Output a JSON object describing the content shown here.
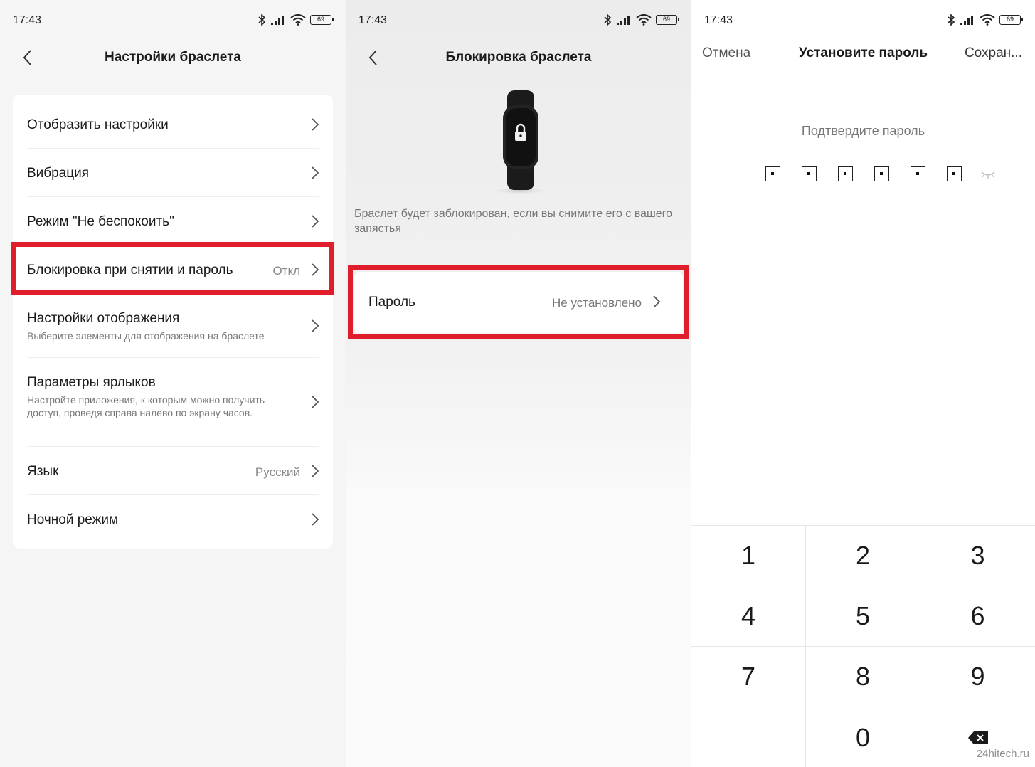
{
  "screen1": {
    "status_time": "17:43",
    "battery": "69",
    "title": "Настройки браслета",
    "items": [
      {
        "label": "Отобразить настройки"
      },
      {
        "label": "Вибрация"
      },
      {
        "label": "Режим \"Не беспокоить\""
      },
      {
        "label": "Блокировка при снятии и пароль",
        "value": "Откл"
      },
      {
        "label": "Настройки отображения",
        "sub": "Выберите элементы для отображения на браслете"
      },
      {
        "label": "Параметры ярлыков",
        "sub": "Настройте приложения, к которым можно получить доступ, проведя справа налево по экрану часов."
      },
      {
        "label": "Язык",
        "value": "Русский"
      },
      {
        "label": "Ночной режим"
      }
    ]
  },
  "screen2": {
    "status_time": "17:43",
    "battery": "69",
    "title": "Блокировка браслета",
    "description": "Браслет будет заблокирован, если вы снимите его с вашего запястья",
    "password_label": "Пароль",
    "password_value": "Не установлено"
  },
  "screen3": {
    "status_time": "17:43",
    "battery": "69",
    "cancel": "Отмена",
    "title": "Установите пароль",
    "save": "Сохран...",
    "prompt": "Подтвердите пароль",
    "pin_length": 6,
    "keys": [
      "1",
      "2",
      "3",
      "4",
      "5",
      "6",
      "7",
      "8",
      "9",
      "",
      "0",
      "backspace"
    ]
  },
  "watermark": "24hitech.ru",
  "colors": {
    "highlight": "#e01e2b",
    "background_list": "#f5f5f5"
  }
}
